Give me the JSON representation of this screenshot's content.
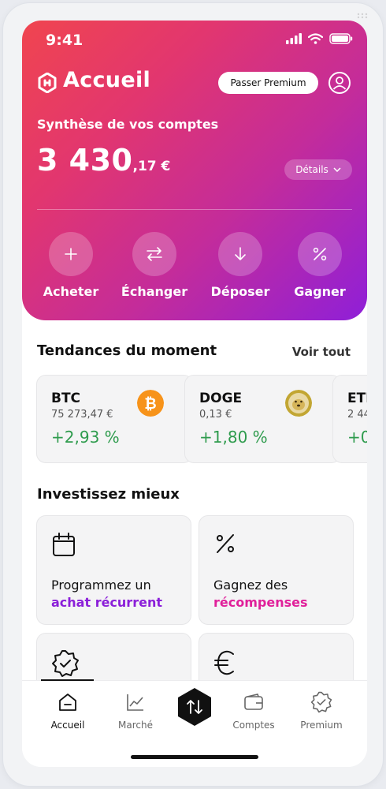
{
  "status": {
    "time": "9:41"
  },
  "header": {
    "title": "Accueil",
    "premium_button": "Passer Premium",
    "summary_label": "Synthèse de vos comptes",
    "balance_int": "3 430",
    "balance_dec": ",17 €",
    "details_button": "Détails"
  },
  "actions": [
    {
      "label": "Acheter",
      "icon": "plus-icon"
    },
    {
      "label": "Échanger",
      "icon": "swap-icon"
    },
    {
      "label": "Déposer",
      "icon": "arrow-down-icon"
    },
    {
      "label": "Gagner",
      "icon": "percent-icon"
    }
  ],
  "trends": {
    "title": "Tendances du moment",
    "see_all": "Voir tout",
    "items": [
      {
        "symbol": "BTC",
        "price": "75 273,47 €",
        "change": "+2,93 %",
        "icon": "bitcoin-icon",
        "color": "#f7931a"
      },
      {
        "symbol": "DOGE",
        "price": "0,13 €",
        "change": "+1,80 %",
        "icon": "dogecoin-icon",
        "color": "#c2a633"
      },
      {
        "symbol": "ETH",
        "price": "2 44",
        "change": "+0",
        "icon": "ethereum-icon"
      }
    ]
  },
  "invest": {
    "title": "Investissez mieux",
    "cards": [
      {
        "line1": "Programmez un",
        "line2": "achat récurrent",
        "accent": "#8b1fd9",
        "icon": "calendar-icon"
      },
      {
        "line1": "Gagnez des",
        "line2": "récompenses",
        "accent": "#e0209a",
        "icon": "percent-icon"
      },
      {
        "line1": "",
        "line2": "",
        "icon": "badge-check-icon"
      },
      {
        "line1": "",
        "line2": "",
        "icon": "euro-icon"
      }
    ]
  },
  "tabs": [
    {
      "label": "Accueil",
      "icon": "home-icon",
      "active": true
    },
    {
      "label": "Marché",
      "icon": "chart-icon",
      "active": false
    },
    {
      "label": "",
      "icon": "swap-vertical-icon",
      "active": false
    },
    {
      "label": "Comptes",
      "icon": "wallet-icon",
      "active": false
    },
    {
      "label": "Premium",
      "icon": "badge-check-icon",
      "active": false
    }
  ],
  "colors": {
    "gradient_start": "#f0454f",
    "gradient_end": "#8f1fd8",
    "positive": "#2e9b4d"
  }
}
